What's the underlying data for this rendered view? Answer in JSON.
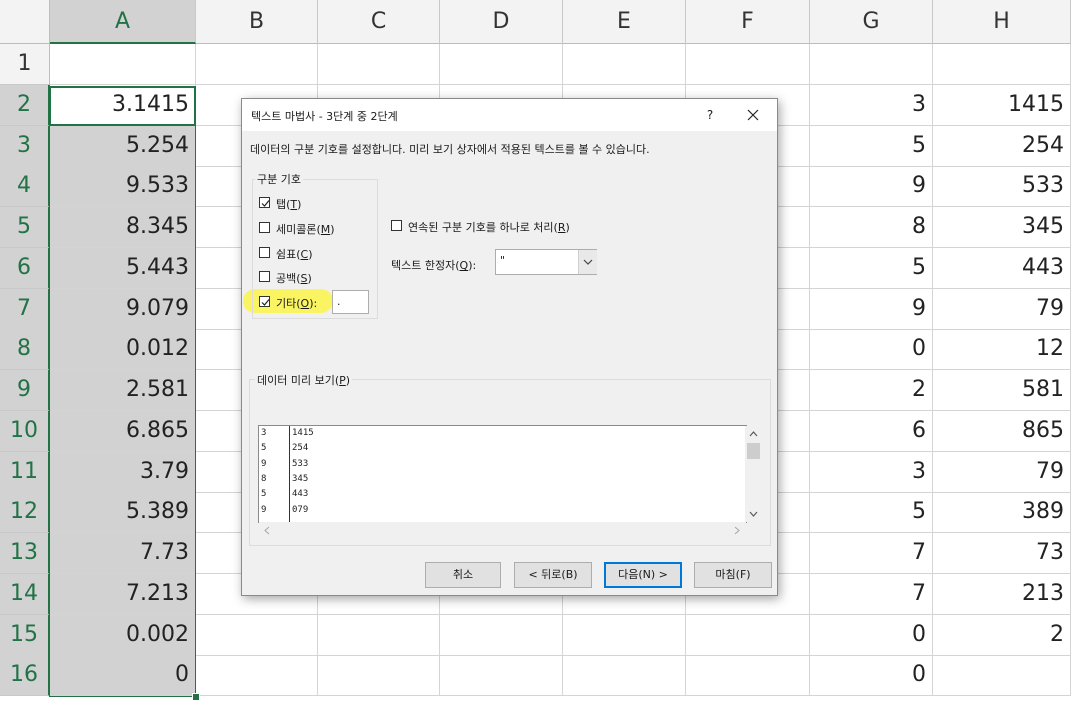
{
  "sheet": {
    "columns": [
      "A",
      "B",
      "C",
      "D",
      "E",
      "F",
      "G",
      "H"
    ],
    "rows": [
      "1",
      "2",
      "3",
      "4",
      "5",
      "6",
      "7",
      "8",
      "9",
      "10",
      "11",
      "12",
      "13",
      "14",
      "15",
      "16"
    ],
    "colA": [
      "",
      "3.1415",
      "5.254",
      "9.533",
      "8.345",
      "5.443",
      "9.079",
      "0.012",
      "2.581",
      "6.865",
      "3.79",
      "5.389",
      "7.73",
      "7.213",
      "0.002",
      "0"
    ],
    "colG": [
      "",
      "3",
      "5",
      "9",
      "8",
      "5",
      "9",
      "0",
      "2",
      "6",
      "3",
      "5",
      "7",
      "7",
      "0",
      "0"
    ],
    "colH": [
      "",
      "1415",
      "254",
      "533",
      "345",
      "443",
      "79",
      "12",
      "581",
      "865",
      "79",
      "389",
      "73",
      "213",
      "2",
      ""
    ],
    "selection_color": "#217346"
  },
  "dialog": {
    "title": "텍스트 마법사 - 3단계 중 2단계",
    "help": "?",
    "instruction": "데이터의 구분 기호를 설정합니다. 미리 보기 상자에서 적용된 텍스트를 볼 수 있습니다.",
    "delimiters": {
      "label": "구분 기호",
      "tab": {
        "label": "탭",
        "key": "T",
        "checked": true
      },
      "semicolon": {
        "label": "세미콜론",
        "key": "M",
        "checked": false
      },
      "comma": {
        "label": "쉼표",
        "key": "C",
        "checked": false
      },
      "space": {
        "label": "공백",
        "key": "S",
        "checked": false
      },
      "other": {
        "label": "기타",
        "key": "O",
        "checked": true,
        "value": "."
      }
    },
    "consecutive": {
      "label": "연속된 구분 기호를 하나로 처리",
      "key": "R",
      "checked": false
    },
    "qualifier": {
      "label": "텍스트 한정자",
      "key": "Q",
      "value": "\""
    },
    "preview": {
      "label": "데이터 미리 보기",
      "key": "P",
      "rows": [
        [
          "3",
          "1415"
        ],
        [
          "5",
          "254"
        ],
        [
          "9",
          "533"
        ],
        [
          "8",
          "345"
        ],
        [
          "5",
          "443"
        ],
        [
          "9",
          "079"
        ]
      ]
    },
    "buttons": {
      "cancel": "취소",
      "back": "< 뒤로(B)",
      "next": "다음(N) >",
      "finish": "마침(F)"
    },
    "highlight_color": "#fbf54a"
  }
}
